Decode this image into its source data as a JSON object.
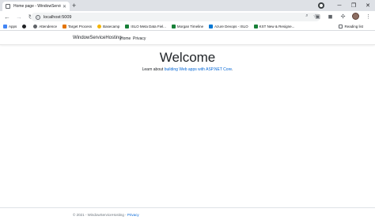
{
  "browser": {
    "tab_title": "Home page - WindowServiceHo...",
    "url": "localhost:5009",
    "bookmarks": [
      {
        "label": "Apps",
        "color": "#4285f4"
      },
      {
        "label": "",
        "color": "#202124"
      },
      {
        "label": "Attendence",
        "color": "#5f6368"
      },
      {
        "label": "Target Process",
        "color": "#e37400"
      },
      {
        "label": "Basecamp",
        "color": "#f4b400"
      },
      {
        "label": "ISLO Meta Data Fiel...",
        "color": "#188038"
      },
      {
        "label": "Morgan Timeline",
        "color": "#188038"
      },
      {
        "label": "Azure Devops - ISLO",
        "color": "#0078d4"
      },
      {
        "label": "KST New & Resigne...",
        "color": "#188038"
      }
    ],
    "reading_list": "Reading list"
  },
  "site": {
    "brand": "WindowServiceHosting",
    "nav": {
      "home": "Home",
      "privacy": "Privacy"
    },
    "heading": "Welcome",
    "learn_prefix": "Learn about ",
    "learn_link": "building Web apps with ASP.NET Core",
    "learn_suffix": ".",
    "footer_text": "© 2021 - WindowServiceHosting - ",
    "footer_link": "Privacy"
  }
}
